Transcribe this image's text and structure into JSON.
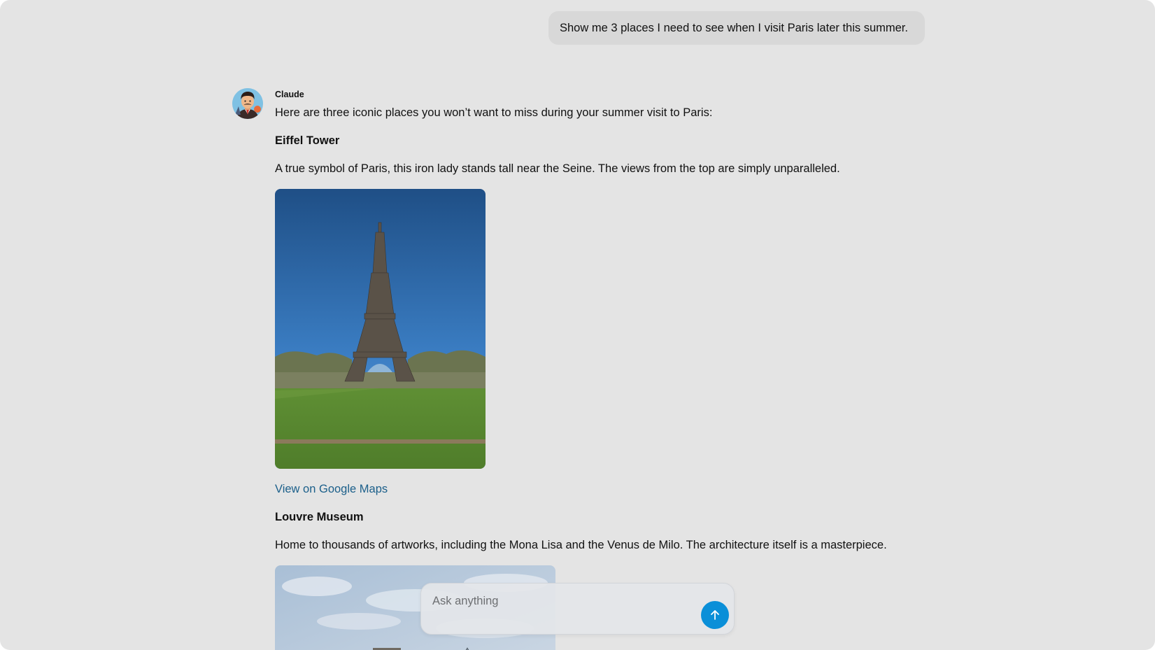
{
  "user_message": "Show me 3 places I need to see when I visit Paris later this summer.",
  "assistant": {
    "name": "Claude",
    "intro": "Here are three iconic places you won’t want to miss during your summer visit to Paris:",
    "places": [
      {
        "title": "Eiffel Tower",
        "description": "A true symbol of Paris, this iron lady stands tall near the Seine. The views from the top are simply unparalleled.",
        "link_label": "View on Google Maps"
      },
      {
        "title": "Louvre Museum",
        "description": "Home to thousands of artworks, including the Mona Lisa and the Venus de Milo. The architecture itself is a masterpiece."
      }
    ]
  },
  "composer": {
    "placeholder": "Ask anything",
    "send_icon": "arrow-up-icon"
  },
  "colors": {
    "background": "#e4e4e4",
    "user_bubble": "#d8d8d8",
    "link": "#1b5f8a",
    "send_button": "#0a8fd8"
  }
}
